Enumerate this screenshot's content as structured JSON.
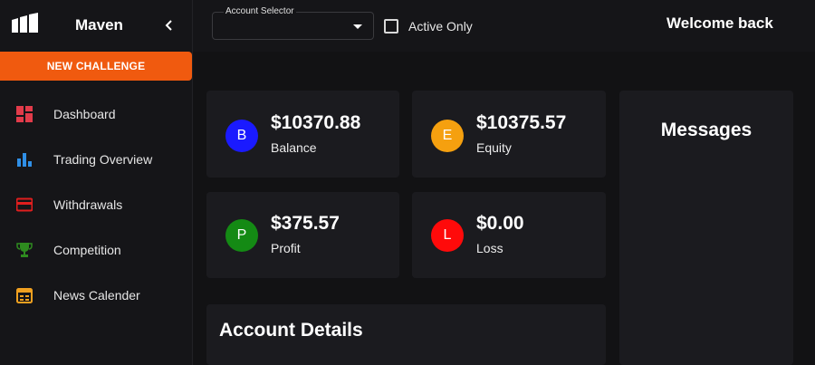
{
  "app": {
    "brand": "Maven"
  },
  "sidebar": {
    "new_challenge_label": "NEW CHALLENGE",
    "items": [
      {
        "label": "Dashboard",
        "icon": "dashboard-icon",
        "color": "#e23b4a"
      },
      {
        "label": "Trading Overview",
        "icon": "bar-chart-icon",
        "color": "#2f8fe6"
      },
      {
        "label": "Withdrawals",
        "icon": "credit-card-icon",
        "color": "#e01e1e"
      },
      {
        "label": "Competition",
        "icon": "trophy-icon",
        "color": "#2e8b1f"
      },
      {
        "label": "News Calender",
        "icon": "calendar-icon",
        "color": "#f0a020"
      }
    ]
  },
  "header": {
    "account_selector_label": "Account Selector",
    "account_selector_value": "",
    "active_only_label": "Active Only",
    "active_only_checked": false,
    "welcome_text": "Welcome back"
  },
  "stats": [
    {
      "letter": "B",
      "value": "$10370.88",
      "caption": "Balance",
      "color": "#1a1aff"
    },
    {
      "letter": "E",
      "value": "$10375.57",
      "caption": "Equity",
      "color": "#f5a00f"
    },
    {
      "letter": "P",
      "value": "$375.57",
      "caption": "Profit",
      "color": "#148a14"
    },
    {
      "letter": "L",
      "value": "$0.00",
      "caption": "Loss",
      "color": "#ff0a0a"
    }
  ],
  "messages": {
    "title": "Messages"
  },
  "account_details": {
    "title": "Account Details"
  },
  "colors": {
    "accent": "#f05a0f",
    "background": "#121214",
    "card": "#1b1b1f"
  }
}
